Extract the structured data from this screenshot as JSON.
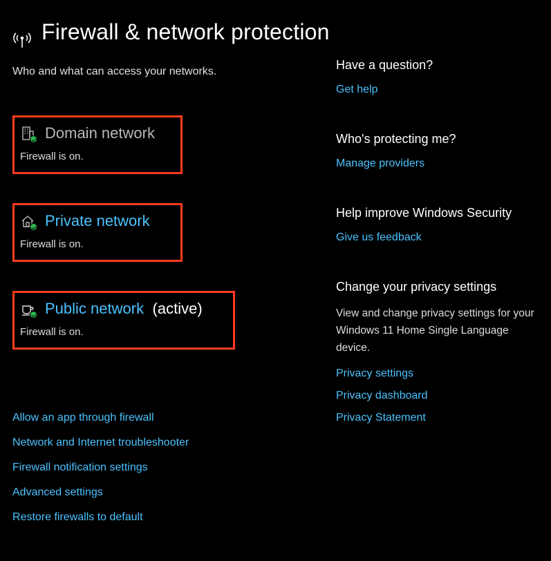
{
  "title": "Firewall & network protection",
  "subtitle": "Who and what can access your networks.",
  "networks": [
    {
      "label": "Domain network",
      "status": "Firewall is on.",
      "active": ""
    },
    {
      "label": "Private network",
      "status": "Firewall is on.",
      "active": ""
    },
    {
      "label": "Public network",
      "status": "Firewall is on.",
      "active": "(active)"
    }
  ],
  "links": {
    "allow": "Allow an app through firewall",
    "troubleshoot": "Network and Internet troubleshooter",
    "notif": "Firewall notification settings",
    "advanced": "Advanced settings",
    "restore": "Restore firewalls to default"
  },
  "sidebar": {
    "question": {
      "title": "Have a question?",
      "link": "Get help"
    },
    "protecting": {
      "title": "Who's protecting me?",
      "link": "Manage providers"
    },
    "improve": {
      "title": "Help improve Windows Security",
      "link": "Give us feedback"
    },
    "privacy": {
      "title": "Change your privacy settings",
      "text": "View and change privacy settings for your Windows 11 Home Single Language device.",
      "link1": "Privacy settings",
      "link2": "Privacy dashboard",
      "link3": "Privacy Statement"
    }
  }
}
